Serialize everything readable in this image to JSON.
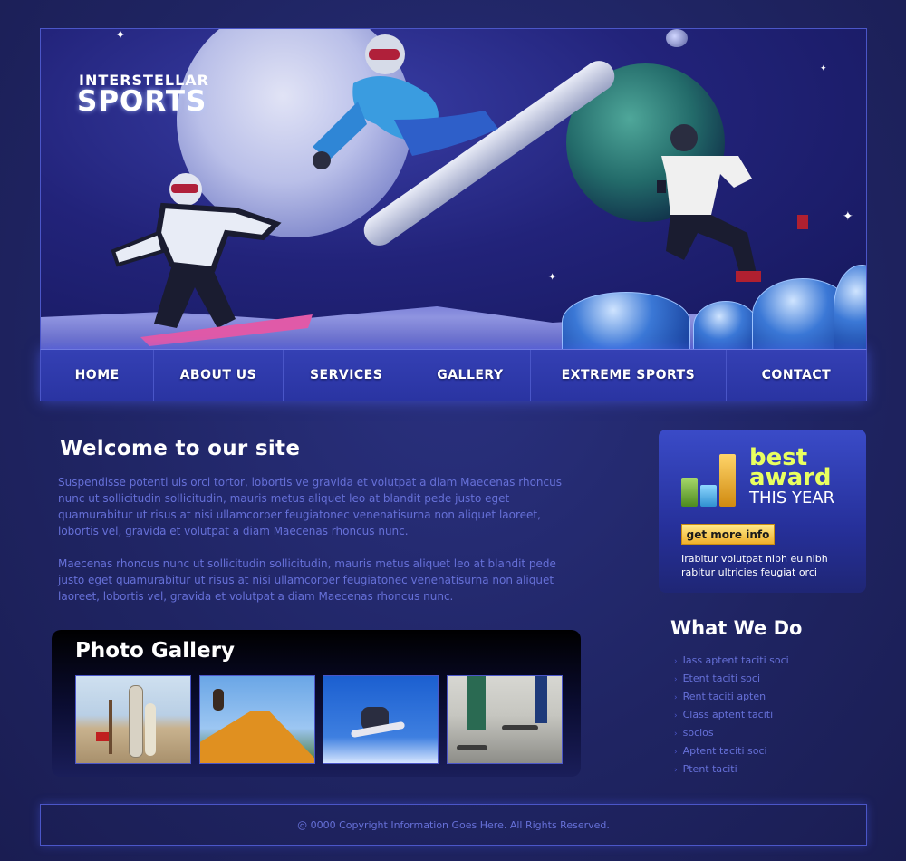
{
  "logo": {
    "line1": "INTERSTELLAR",
    "line2": "SPORTS"
  },
  "nav": {
    "items": [
      {
        "label": "HOME"
      },
      {
        "label": "ABOUT US"
      },
      {
        "label": "SERVICES"
      },
      {
        "label": "GALLERY"
      },
      {
        "label": "EXTREME SPORTS"
      },
      {
        "label": "CONTACT"
      }
    ]
  },
  "welcome": {
    "title": "Welcome to our site",
    "paragraph1": "Suspendisse potenti uis orci tortor, lobortis ve gravida et volutpat a diam Maecenas rhoncus nunc ut sollicitudin sollicitudin, mauris metus aliquet leo at blandit pede justo eget quamurabitur ut risus at nisi ullamcorper feugiatonec venenatisurna non aliquet laoreet, lobortis vel, gravida et volutpat a diam Maecenas rhoncus nunc.",
    "paragraph2": "Maecenas rhoncus nunc ut sollicitudin sollicitudin, mauris metus aliquet leo at blandit pede justo eget quamurabitur ut risus at nisi ullamcorper feugiatonec venenatisurna non aliquet laoreet, lobortis vel, gravida et volutpat a diam Maecenas rhoncus nunc."
  },
  "gallery": {
    "title": "Photo Gallery",
    "thumbs": [
      {
        "icon": "beach-surfboards-photo"
      },
      {
        "icon": "skate-ramp-photo"
      },
      {
        "icon": "snowboard-jump-photo"
      },
      {
        "icon": "street-skateboard-photo"
      }
    ]
  },
  "award": {
    "best": "best",
    "award": "award",
    "this_year": "THIS YEAR",
    "button": "get more info",
    "text": "Irabitur volutpat nibh eu nibh rabitur ultricies feugiat orci"
  },
  "what_we_do": {
    "title": "What We Do",
    "items": [
      {
        "label": "Iass aptent taciti soci"
      },
      {
        "label": "Etent taciti soci"
      },
      {
        "label": "Rent taciti apten"
      },
      {
        "label": "Class aptent taciti"
      },
      {
        "label": "socios"
      },
      {
        "label": "Aptent taciti soci"
      },
      {
        "label": "Ptent taciti"
      }
    ]
  },
  "footer": {
    "text": "@ 0000 Copyright Information Goes Here. All Rights Reserved."
  },
  "colors": {
    "background": "#242a6e",
    "nav": "#2e38a8",
    "body_text": "#6670d8",
    "award_highlight": "#e9ff60",
    "button": "#f0b02c"
  }
}
